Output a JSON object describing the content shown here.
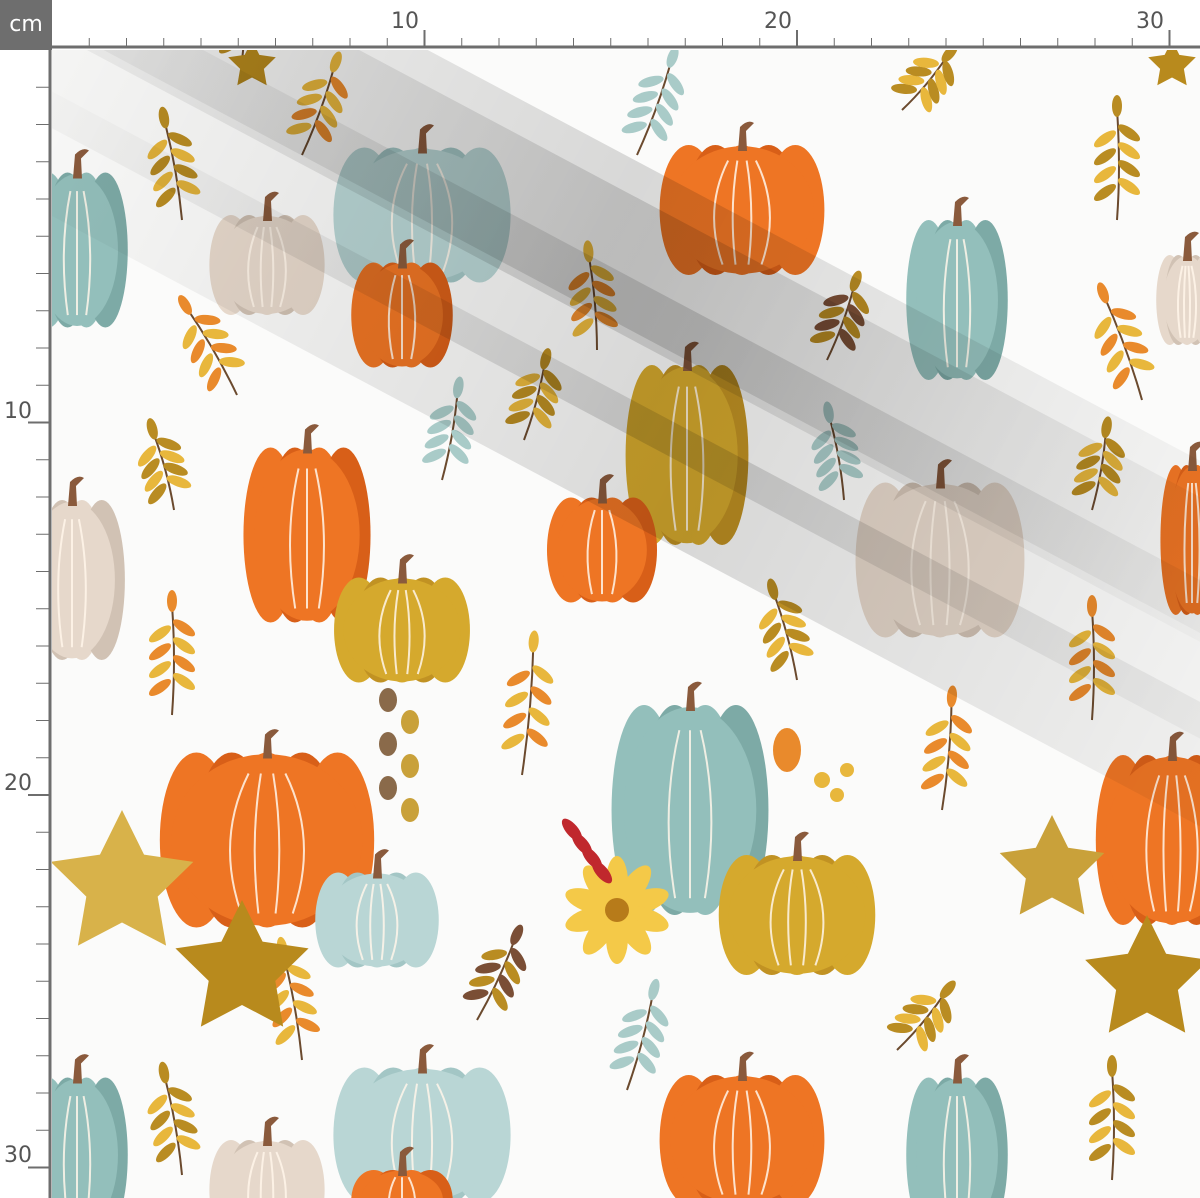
{
  "ruler": {
    "unit": "cm",
    "top_labels": [
      "10",
      "20",
      "30"
    ],
    "left_labels": [
      "10",
      "20",
      "30"
    ]
  },
  "colors": {
    "background": "#fbfbfa",
    "ruler_line": "#6e6e6e",
    "pumpkin_orange": "#ee7524",
    "pumpkin_teal": "#93bfbb",
    "pumpkin_pale_blue": "#b9d6d5",
    "pumpkin_beige": "#e6d8cb",
    "pumpkin_mustard": "#d5a92d",
    "stem_brown": "#8a5a3c",
    "leaf_gold": "#e8b73c",
    "leaf_orange": "#e98a2c",
    "leaf_olive": "#b98c22",
    "leaf_mint": "#a9cbc8",
    "flower_yellow": "#f4c948",
    "berry_red": "#c0282d"
  }
}
